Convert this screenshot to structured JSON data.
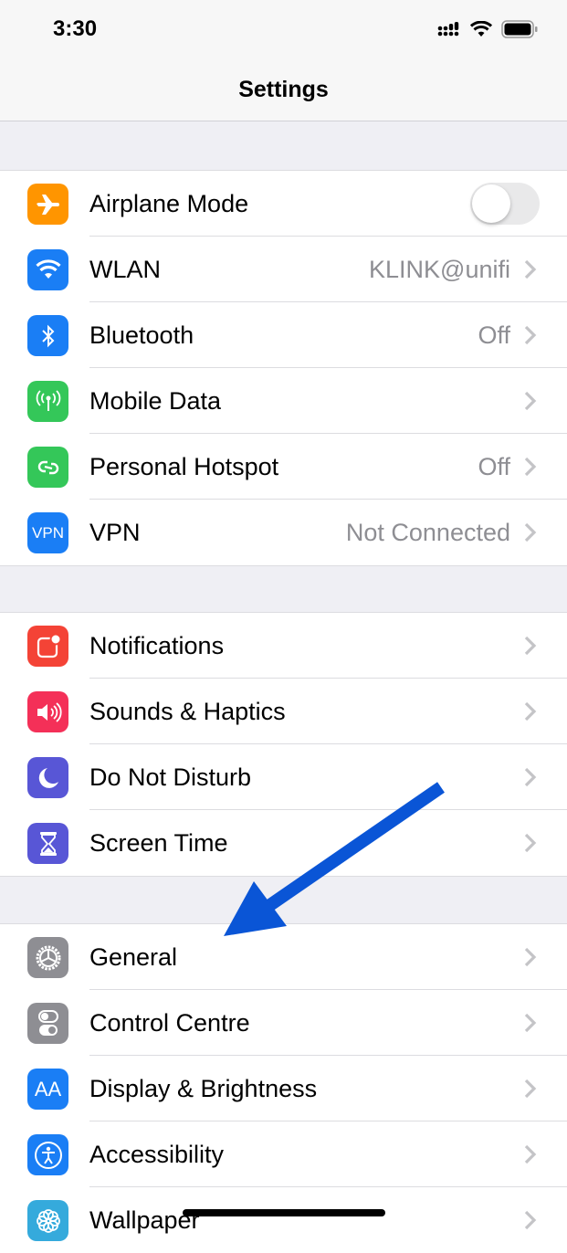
{
  "status_bar": {
    "time": "3:30",
    "icons": [
      "cellular-signal-icon",
      "wifi-icon",
      "battery-icon"
    ]
  },
  "nav": {
    "title": "Settings"
  },
  "groups": [
    {
      "items": [
        {
          "label": "Airplane Mode",
          "icon": "airplane-icon",
          "color": "#ff9500",
          "toggle": true,
          "toggle_on": false
        },
        {
          "label": "WLAN",
          "icon": "wifi-icon",
          "color": "#1a7ef5",
          "value": "KLINK@unifi"
        },
        {
          "label": "Bluetooth",
          "icon": "bluetooth-icon",
          "color": "#1a7ef5",
          "value": "Off"
        },
        {
          "label": "Mobile Data",
          "icon": "antenna-icon",
          "color": "#34c759",
          "value": ""
        },
        {
          "label": "Personal Hotspot",
          "icon": "hotspot-icon",
          "color": "#34c759",
          "value": "Off"
        },
        {
          "label": "VPN",
          "icon": "vpn-icon",
          "icon_text": "VPN",
          "color": "#1a7ef5",
          "value": "Not Connected"
        }
      ]
    },
    {
      "items": [
        {
          "label": "Notifications",
          "icon": "notifications-icon",
          "color": "#f44336"
        },
        {
          "label": "Sounds & Haptics",
          "icon": "speaker-icon",
          "color": "#f43058"
        },
        {
          "label": "Do Not Disturb",
          "icon": "moon-icon",
          "color": "#5856d6"
        },
        {
          "label": "Screen Time",
          "icon": "hourglass-icon",
          "color": "#5856d6"
        }
      ]
    },
    {
      "items": [
        {
          "label": "General",
          "icon": "gear-icon",
          "color": "#8e8e93"
        },
        {
          "label": "Control Centre",
          "icon": "switches-icon",
          "color": "#8e8e93"
        },
        {
          "label": "Display & Brightness",
          "icon": "text-size-icon",
          "icon_text": "AA",
          "color": "#1a7ef5"
        },
        {
          "label": "Accessibility",
          "icon": "accessibility-icon",
          "color": "#1a7ef5"
        },
        {
          "label": "Wallpaper",
          "icon": "flower-icon",
          "color": "#35aadc"
        }
      ]
    }
  ],
  "annotation": {
    "arrow_color": "#0a55d6",
    "points_to": "General"
  }
}
